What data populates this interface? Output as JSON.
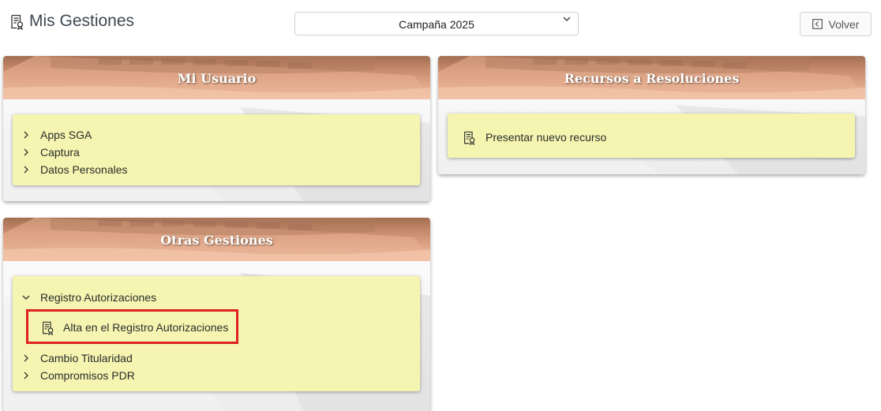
{
  "header": {
    "title": "Mis Gestiones",
    "title_icon": "document-certificate-icon",
    "campaign_select": {
      "value": "Campaña 2025",
      "icon": "chevron-down-icon"
    },
    "back_button": {
      "label": "Volver",
      "icon": "back-arrow-box-icon"
    }
  },
  "panels": {
    "mi_usuario": {
      "title": "Mi Usuario",
      "items": [
        {
          "label": "Apps SGA",
          "icon": "chevron-right-icon"
        },
        {
          "label": "Captura",
          "icon": "chevron-right-icon"
        },
        {
          "label": "Datos Personales",
          "icon": "chevron-right-icon"
        }
      ]
    },
    "recursos": {
      "title": "Recursos a Resoluciones",
      "items": [
        {
          "label": "Presentar nuevo recurso",
          "icon": "document-certificate-icon"
        }
      ]
    },
    "otras": {
      "title": "Otras Gestiones",
      "items": [
        {
          "label": "Registro Autorizaciones",
          "icon": "chevron-down-icon",
          "expanded": true,
          "children": [
            {
              "label": "Alta en el Registro Autorizaciones",
              "icon": "document-certificate-icon",
              "highlighted": true
            }
          ]
        },
        {
          "label": "Cambio Titularidad",
          "icon": "chevron-right-icon"
        },
        {
          "label": "Compromisos PDR",
          "icon": "chevron-right-icon"
        }
      ]
    }
  },
  "colors": {
    "menu_background": "#f5f5b1",
    "header_band": "#c58a6b",
    "highlight_border": "#e0211d"
  }
}
